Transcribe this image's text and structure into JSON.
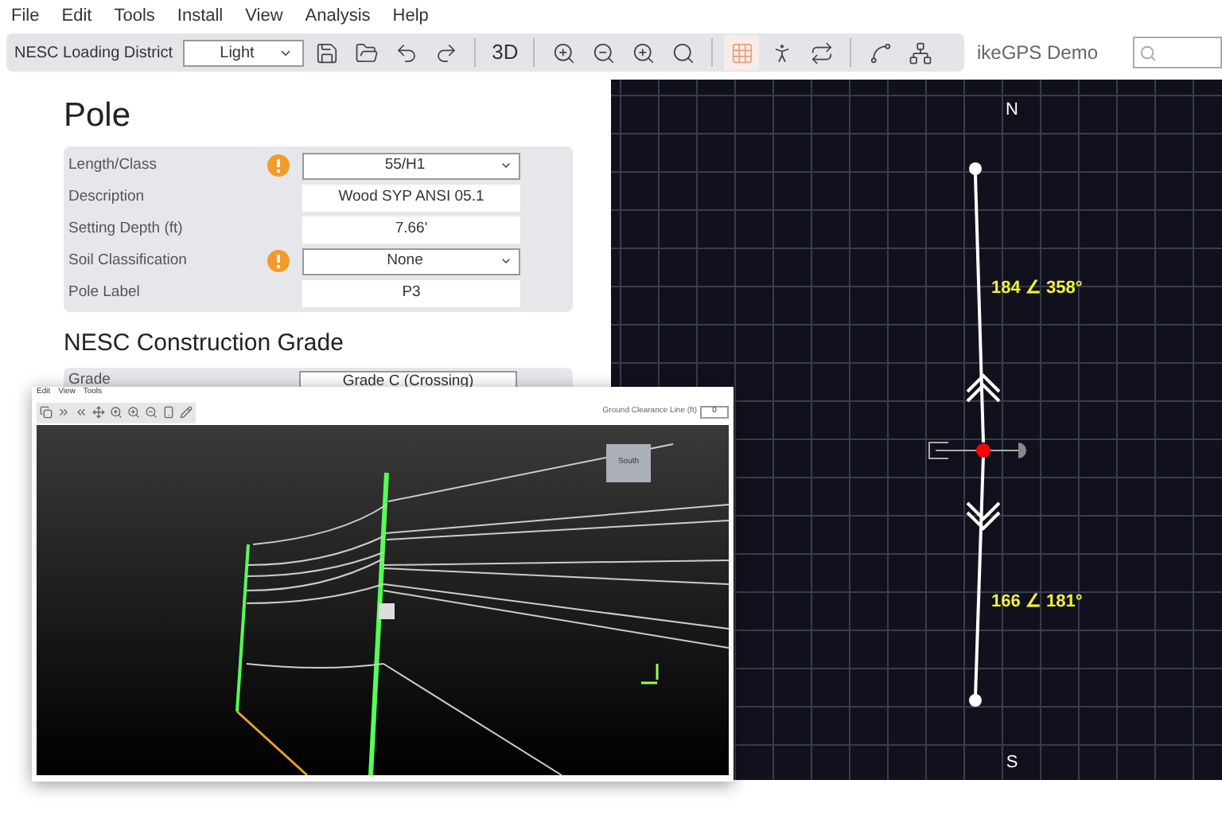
{
  "menu": [
    "File",
    "Edit",
    "Tools",
    "Install",
    "View",
    "Analysis",
    "Help"
  ],
  "toolbar": {
    "district_label": "NESC Loading District",
    "district_value": "Light",
    "buttons": [
      {
        "kind": "icon",
        "selected": false
      },
      {
        "kind": "icon",
        "selected": false
      },
      {
        "kind": "icon",
        "selected": false
      },
      {
        "kind": "icon",
        "selected": false
      },
      {
        "kind": "text",
        "label": "3D",
        "selected": false
      },
      {
        "kind": "icon",
        "selected": false
      },
      {
        "kind": "icon",
        "selected": false
      },
      {
        "kind": "icon",
        "selected": false
      },
      {
        "kind": "icon",
        "selected": false
      },
      {
        "kind": "icon",
        "selected": true
      },
      {
        "kind": "icon",
        "selected": false
      },
      {
        "kind": "icon",
        "selected": false
      },
      {
        "kind": "icon",
        "selected": false
      },
      {
        "kind": "icon",
        "selected": false
      }
    ]
  },
  "app_title": "ikeGPS Demo",
  "pole": {
    "title": "Pole",
    "fields": [
      {
        "label": "Length/Class",
        "warning": true,
        "kind": "select",
        "value": "55/H1"
      },
      {
        "label": "Description",
        "warning": false,
        "kind": "text",
        "value": "Wood SYP ANSI 05.1"
      },
      {
        "label": "Setting Depth (ft)",
        "warning": false,
        "kind": "text",
        "value": "7.66'"
      },
      {
        "label": "Soil Classification",
        "warning": true,
        "kind": "select",
        "value": "None"
      },
      {
        "label": "Pole Label",
        "warning": false,
        "kind": "text",
        "value": "P3"
      }
    ]
  },
  "grade": {
    "title": "NESC Construction Grade",
    "label": "Grade",
    "value": "Grade C (Crossing)"
  },
  "map": {
    "north": "N",
    "south": "S",
    "spans": [
      "184 ∠ 358°",
      "166 ∠ 181°"
    ]
  },
  "viewer": {
    "menu": [
      "Edit",
      "View",
      "Tools"
    ],
    "clearance_label": "Ground Clearance Line (ft)",
    "clearance_value": "0",
    "cube_label": "South"
  }
}
